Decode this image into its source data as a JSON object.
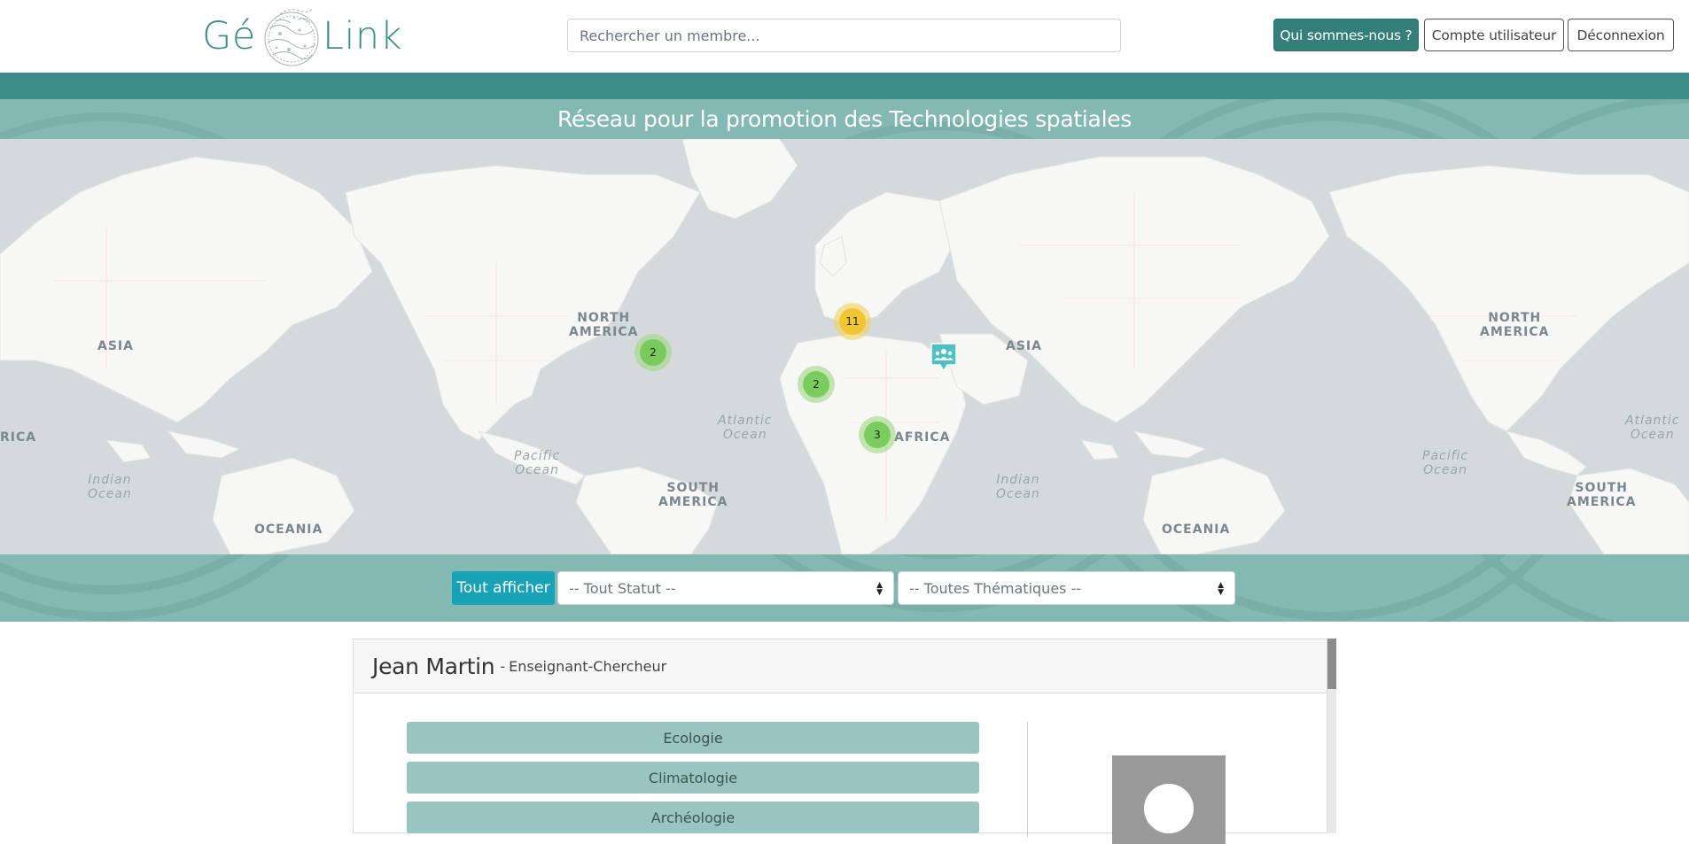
{
  "header": {
    "logo_left": "Gé",
    "logo_right": "Link",
    "search_placeholder": "Rechercher un membre...",
    "buttons": {
      "about": "Qui sommes-nous ?",
      "account": "Compte utilisateur",
      "logout": "Déconnexion"
    }
  },
  "banner": {
    "title": "Réseau pour la promotion des Technologies spatiales"
  },
  "map": {
    "continent_labels": [
      "ASIA",
      "NORTH AMERICA",
      "ASIA",
      "NORTH AMERICA",
      "AFRICA",
      "SOUTH AMERICA",
      "SOUTH AMERICA",
      "OCEANIA",
      "OCEANIA",
      "RICA"
    ],
    "labels": {
      "asia_left": "ASIA",
      "north_america": "NORTH\nAMERICA",
      "asia_center": "ASIA",
      "north_america_right": "NORTH\nAMERICA",
      "africa": "AFRICA",
      "south_america": "SOUTH\nAMERICA",
      "south_america_right": "SOUTH\nAMERICA",
      "oceania_left": "OCEANIA",
      "oceania_right": "OCEANIA",
      "africa_left_cut": "RICA"
    },
    "oceans": {
      "indian_left": "Indian\nOcean",
      "pacific_center": "Pacific\nOcean",
      "atlantic_center": "Atlantic\nOcean",
      "indian_center": "Indian\nOcean",
      "pacific_right": "Pacific\nOcean",
      "atlantic_right": "Atlantic\nOcean"
    },
    "clusters": {
      "north_america": "2",
      "europe": "11",
      "west_africa": "2",
      "central_africa": "3"
    },
    "marker_icon": "group-icon"
  },
  "filters": {
    "show_all": "Tout afficher",
    "status_select": "-- Tout Statut --",
    "theme_select": "-- Toutes Thématiques --"
  },
  "member": {
    "name": "Jean Martin",
    "separator": "-",
    "role": "Enseignant-Chercheur",
    "themes": [
      "Ecologie",
      "Climatologie",
      "Archéologie"
    ]
  },
  "colors": {
    "brand_teal": "#3b8c86",
    "band_teal": "#84b8b2",
    "theme_chip": "#9ac4c1",
    "show_all_button": "#17a2b8",
    "cluster_green": "#6ec850",
    "cluster_yellow": "#f0c328"
  }
}
